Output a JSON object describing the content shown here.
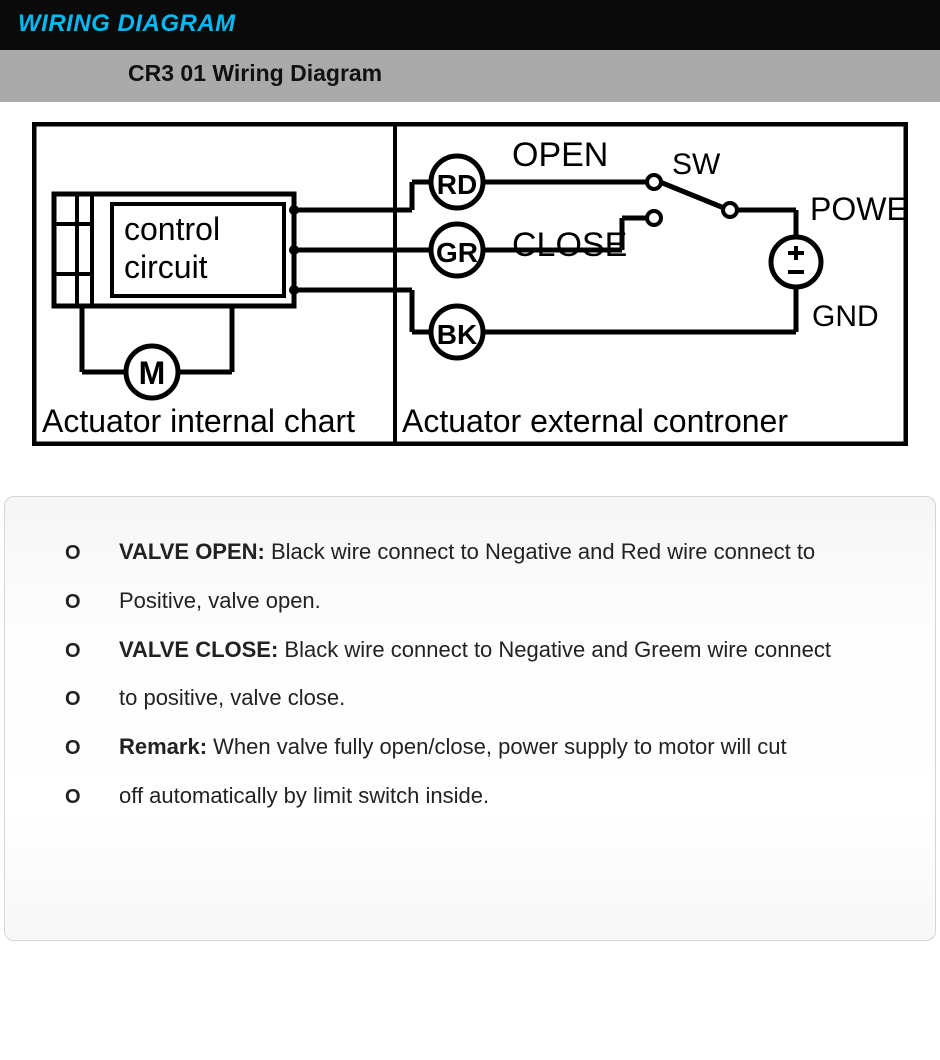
{
  "header": {
    "title": "WIRING DIAGRAM"
  },
  "subheader": {
    "title": "CR3 01 Wiring Diagram"
  },
  "diagram": {
    "control_box_l1": "control",
    "control_box_l2": "circuit",
    "motor": "M",
    "rd": "RD",
    "gr": "GR",
    "bk": "BK",
    "open": "OPEN",
    "close": "CLOSE",
    "sw": "SW",
    "power": "POWER",
    "gnd": "GND",
    "left_caption": "Actuator internal chart",
    "right_caption": "Actuator external controner"
  },
  "desc": {
    "rows": [
      {
        "bold": "VALVE OPEN: ",
        "text": "Black wire connect to Negative and Red wire connect to"
      },
      {
        "bold": "",
        "text": "Positive, valve open."
      },
      {
        "bold": "VALVE CLOSE: ",
        "text": "Black wire connect to Negative and Greem wire connect"
      },
      {
        "bold": "",
        "text": "to positive, valve close."
      },
      {
        "bold": "Remark: ",
        "text": "When valve fully open/close, power supply to motor will cut"
      },
      {
        "bold": "",
        "text": "off automatically by limit switch inside."
      }
    ]
  }
}
